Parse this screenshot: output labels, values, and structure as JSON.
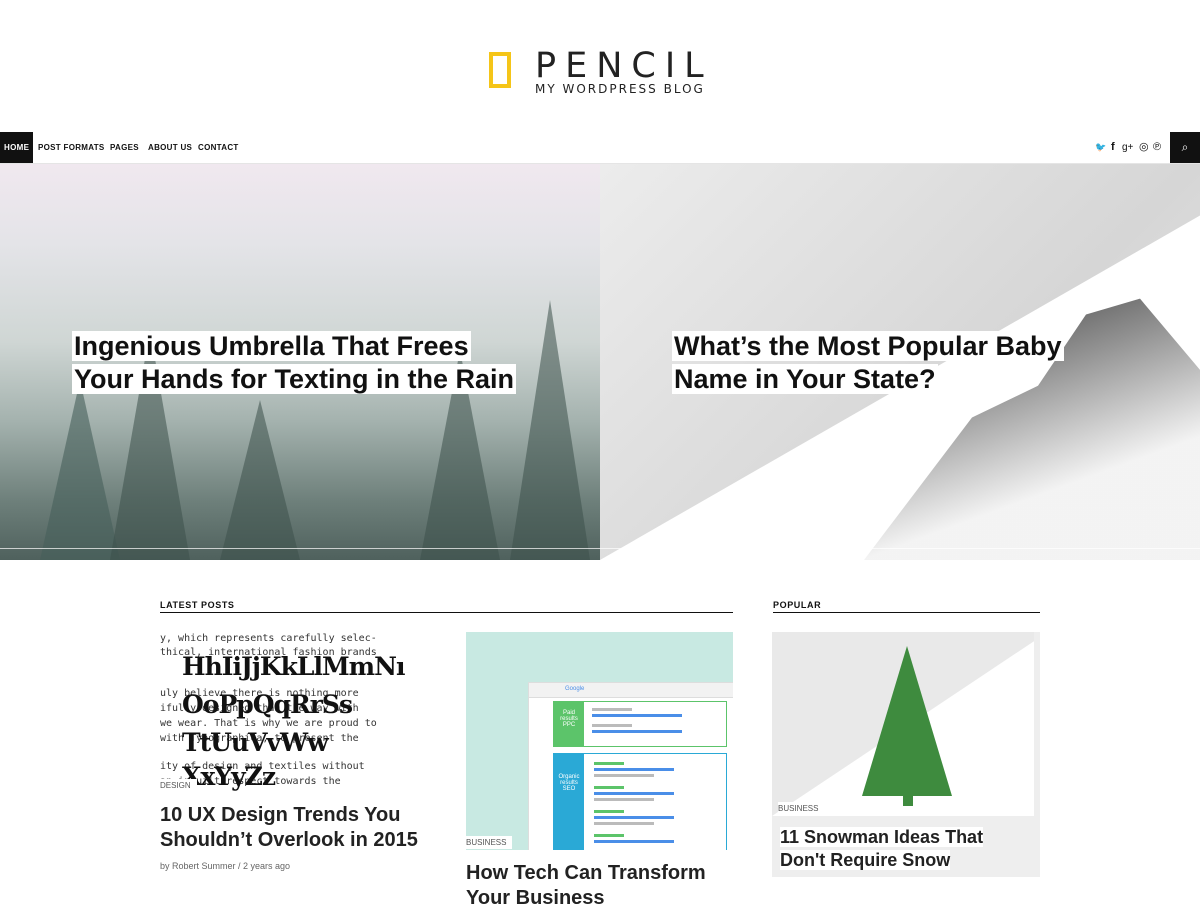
{
  "site": {
    "title": "PENCIL",
    "tagline": "MY WORDPRESS BLOG",
    "accent": "#f5c518"
  },
  "nav": {
    "items": [
      "HOME",
      "POST FORMATS",
      "PAGES",
      "ABOUT US",
      "CONTACT"
    ],
    "active": "HOME",
    "social_icons": [
      "twitter-icon",
      "facebook-icon",
      "google-plus-icon",
      "instagram-icon",
      "pinterest-icon"
    ],
    "social_glyphs": [
      "🐦",
      "f",
      "g+",
      "◎",
      "℗"
    ],
    "search_glyph": "⌕"
  },
  "hero": [
    {
      "title_line1": "Ingenious Umbrella That Frees",
      "title_line2": "Your Hands for Texting in the Rain"
    },
    {
      "title_line1": "What’s the Most Popular Baby",
      "title_line2": "Name in Your State?"
    }
  ],
  "latest": {
    "heading": "LATEST POSTS",
    "posts": [
      {
        "category": "DESIGN",
        "title_line1": "10 UX Design Trends You",
        "title_line2": "Shouldn’t Overlook in 2015",
        "meta": "by Robert Summer / 2 years ago",
        "image_text": {
          "mono": [
            "y, which represents carefully selec-",
            "thical, international fashion brands",
            "",
            "uly believe there is nothing more",
            "ifully designed than the way with",
            "we wear. That is why we are proud to",
            "with Typographica, to present the",
            "ity of design and textiles without",
            "",
            "an inbuilt respect towards the"
          ],
          "big": [
            "HhIiJjKkLlMmNı",
            "OoPpQqRrSs",
            "TtUuVvWw",
            "XxYyZz"
          ]
        }
      },
      {
        "category": "BUSINESS",
        "title_line1": "How Tech Can Transform",
        "title_line2": "Your Business",
        "image_text": {
          "brand": "Google",
          "paid": "Paid results",
          "paid_abbr": "PPC",
          "organic": "Organic results",
          "organic_abbr": "SEO"
        }
      }
    ]
  },
  "popular": {
    "heading": "POPULAR",
    "posts": [
      {
        "category": "BUSINESS",
        "title_line1": "11 Snowman Ideas That",
        "title_line2": "Don't Require Snow"
      }
    ]
  }
}
